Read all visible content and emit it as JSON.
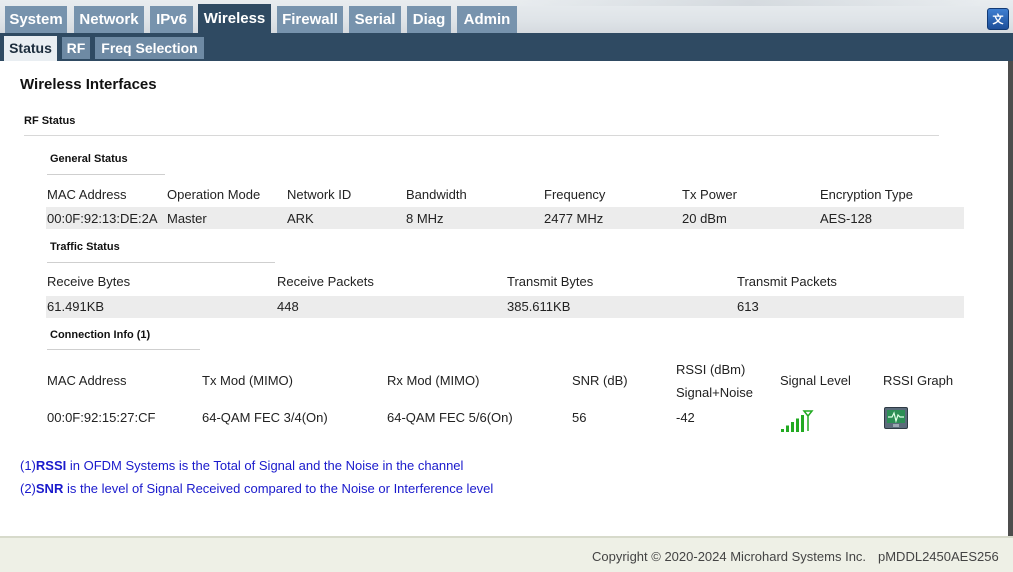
{
  "top_tabs": [
    {
      "label": "System"
    },
    {
      "label": "Network"
    },
    {
      "label": "IPv6"
    },
    {
      "label": "Wireless",
      "active": true
    },
    {
      "label": "Firewall"
    },
    {
      "label": "Serial"
    },
    {
      "label": "Diag"
    },
    {
      "label": "Admin"
    }
  ],
  "sub_tabs": [
    {
      "label": "Status",
      "active": true
    },
    {
      "label": "RF"
    },
    {
      "label": "Freq Selection"
    }
  ],
  "page_title": "Wireless Interfaces",
  "rf_status": {
    "title": "RF Status",
    "general": {
      "title": "General Status",
      "headers": [
        "MAC Address",
        "Operation Mode",
        "Network ID",
        "Bandwidth",
        "Frequency",
        "Tx Power",
        "Encryption Type"
      ],
      "values": [
        "00:0F:92:13:DE:2A",
        "Master",
        "ARK",
        "8 MHz",
        "2477 MHz",
        "20 dBm",
        "AES-128"
      ]
    },
    "traffic": {
      "title": "Traffic Status",
      "headers": [
        "Receive Bytes",
        "Receive Packets",
        "Transmit Bytes",
        "Transmit Packets"
      ],
      "values": [
        "61.491KB",
        "448",
        "385.611KB",
        "613"
      ]
    },
    "connection": {
      "title": "Connection Info (1)",
      "headers": [
        "MAC Address",
        "Tx Mod (MIMO)",
        "Rx Mod (MIMO)",
        "SNR (dB)",
        "RSSI (dBm)",
        "Signal Level",
        "RSSI Graph"
      ],
      "rssi_sub": "Signal+Noise",
      "rows": [
        {
          "mac": "00:0F:92:15:27:CF",
          "tx_mod": "64-QAM FEC 3/4(On)",
          "rx_mod": "64-QAM FEC 5/6(On)",
          "snr": "56",
          "rssi": "-42",
          "signal_bars": 5,
          "signal_max": 5
        }
      ]
    }
  },
  "notes": [
    {
      "prefix": "(1)",
      "term": "RSSI",
      "text": " in OFDM Systems is the Total of Signal and the Noise in the channel"
    },
    {
      "prefix": "(2)",
      "term": "SNR",
      "text": " is the level of Signal Received compared to the Noise or Interference level"
    }
  ],
  "footer": {
    "copyright": "Copyright © 2020-2024 Microhard Systems Inc.",
    "model": "pMDDL2450AES256"
  },
  "colors": {
    "tab_bg": "#7793ad",
    "tab_active_bg": "#2f4a62",
    "note_text": "#1a1acc",
    "signal_green": "#22aa22"
  },
  "icons": {
    "language": "language-icon",
    "signal": "signal-level-icon",
    "graph": "rssi-graph-icon"
  }
}
